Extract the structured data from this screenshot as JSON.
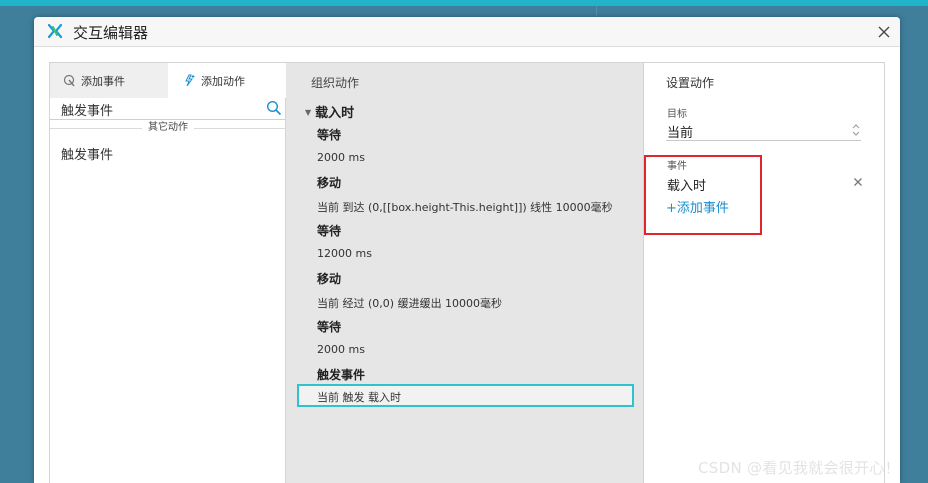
{
  "window": {
    "title": "交互编辑器"
  },
  "left_panel": {
    "tabs": [
      "添加事件",
      "添加动作"
    ],
    "search_value": "触发事件",
    "group_label": "其它动作",
    "items": [
      "触发事件"
    ]
  },
  "middle_panel": {
    "title": "组织动作",
    "event": "载入时",
    "actions": [
      {
        "name": "等待",
        "detail": "2000 ms"
      },
      {
        "name": "移动",
        "detail": "当前 到达 (0,[[box.height-This.height]]) 线性 10000毫秒"
      },
      {
        "name": "等待",
        "detail": "12000 ms"
      },
      {
        "name": "移动",
        "detail": "当前 经过 (0,0) 缓进缓出 10000毫秒"
      },
      {
        "name": "等待",
        "detail": "2000 ms"
      },
      {
        "name": "触发事件",
        "detail": "当前 触发 载入时"
      }
    ]
  },
  "right_panel": {
    "title": "设置动作",
    "target_label": "目标",
    "target_value": "当前",
    "events_label": "事件",
    "event_entry": "载入时",
    "add_event": "+添加事件"
  },
  "watermark": "CSDN @看见我就会很开心！",
  "colors": {
    "selection_border": "#2fc3d0",
    "annotation_border": "#e0262b",
    "link": "#1a8fd1"
  }
}
